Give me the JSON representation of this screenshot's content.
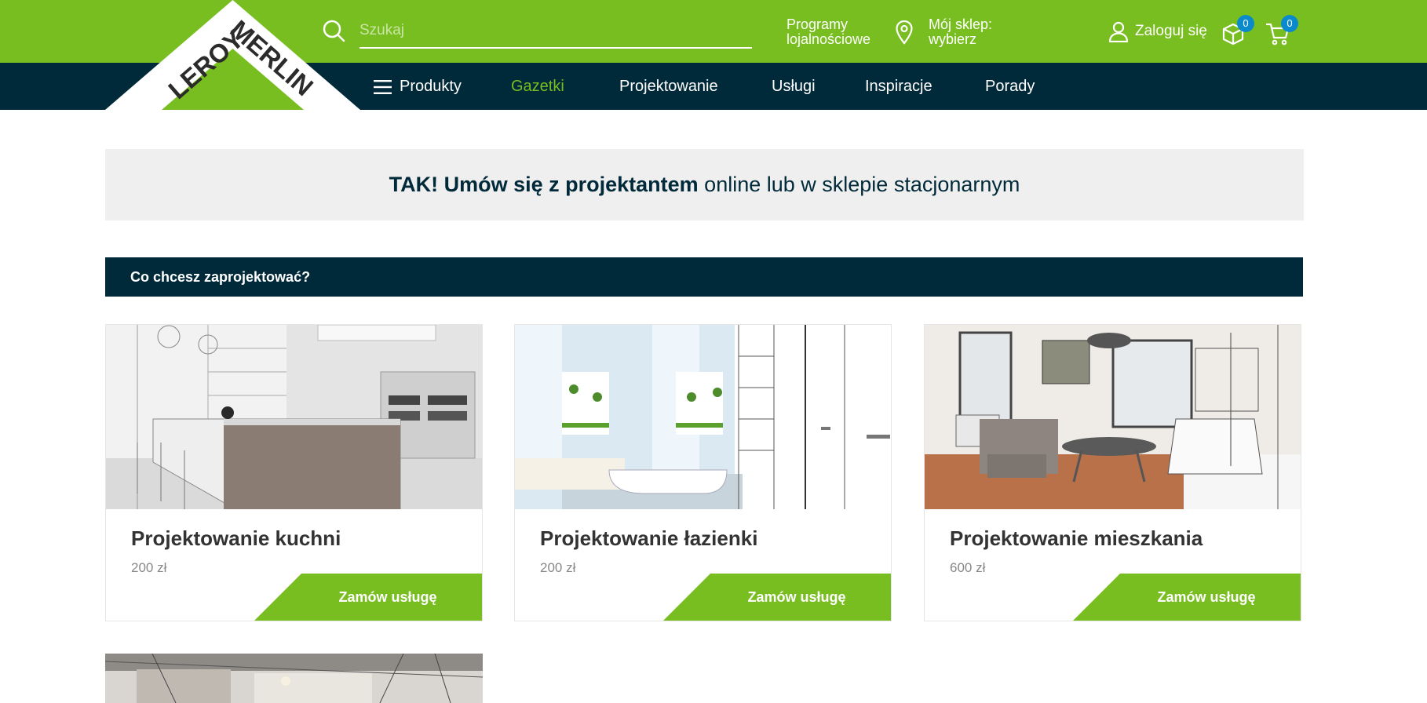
{
  "header": {
    "search": {
      "placeholder": "Szukaj",
      "icon": "search-icon"
    },
    "loyalty": {
      "line1": "Programy",
      "line2": "lojalnościowe"
    },
    "store": {
      "line1": "Mój sklep:",
      "line2": "wybierz",
      "icon": "map-pin-icon"
    },
    "login": {
      "label": "Zaloguj się",
      "icon": "user-icon"
    },
    "orders": {
      "count": "0",
      "icon": "box-icon"
    },
    "cart": {
      "count": "0",
      "icon": "cart-icon"
    },
    "logo": {
      "line1": "LEROY",
      "line2": "MERLIN"
    }
  },
  "nav": {
    "items": [
      {
        "label": "Produkty",
        "active": false
      },
      {
        "label": "Gazetki",
        "active": true
      },
      {
        "label": "Projektowanie",
        "active": false
      },
      {
        "label": "Usługi",
        "active": false
      },
      {
        "label": "Inspiracje",
        "active": false
      },
      {
        "label": "Porady",
        "active": false
      }
    ]
  },
  "banner": {
    "bold": "TAK! Umów się z projektantem",
    "rest": " online lub w sklepie stacjonarnym"
  },
  "section": {
    "title": "Co chcesz zaprojektować?"
  },
  "cards": [
    {
      "title": "Projektowanie kuchni",
      "price": "200 zł",
      "button": "Zamów usługę"
    },
    {
      "title": "Projektowanie łazienki",
      "price": "200 zł",
      "button": "Zamów usługę"
    },
    {
      "title": "Projektowanie mieszkania",
      "price": "600 zł",
      "button": "Zamów usługę"
    }
  ],
  "colors": {
    "brand_green": "#78be20",
    "navy": "#002a3a",
    "badge_blue": "#0a8acb",
    "banner_bg": "#efefef"
  }
}
